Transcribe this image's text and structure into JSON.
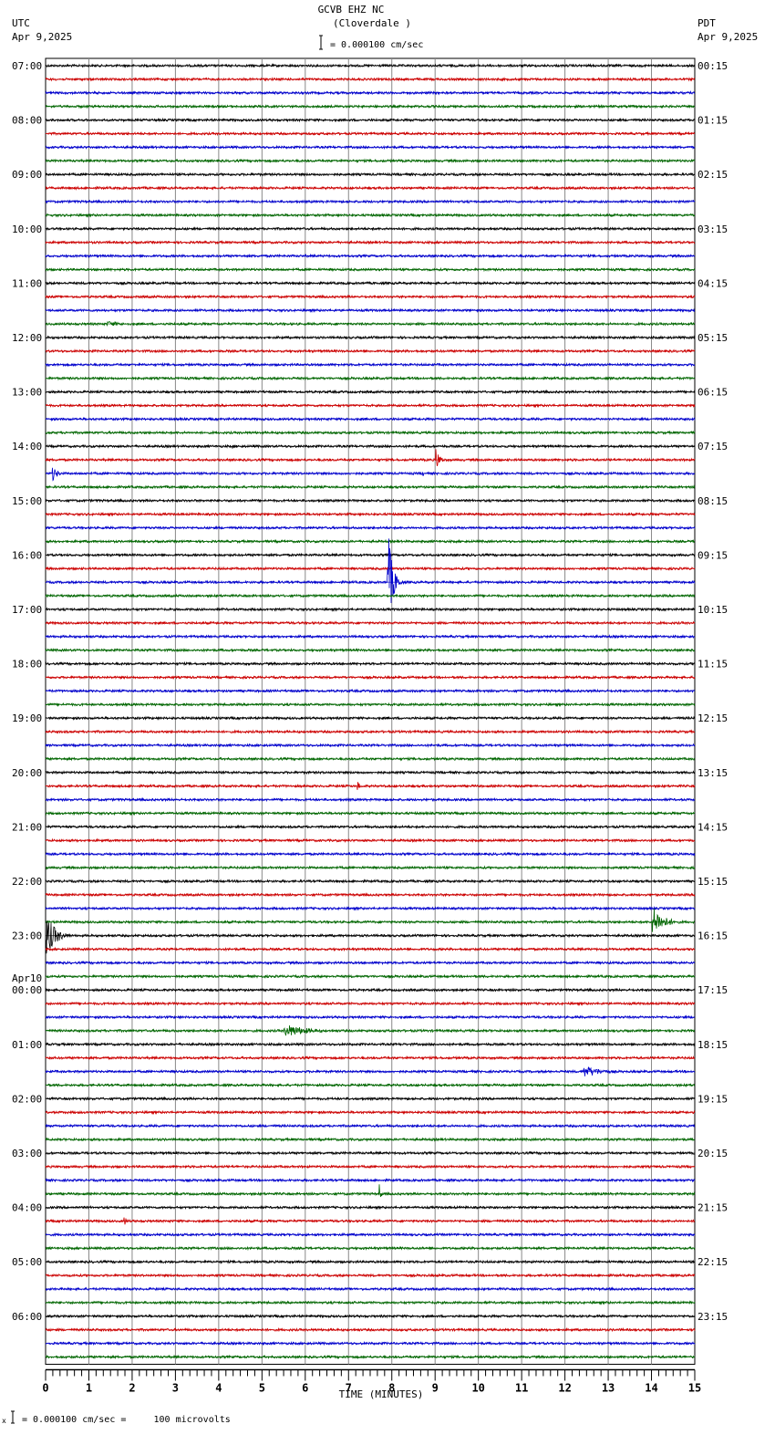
{
  "chart_data": {
    "type": "line",
    "title": "GCVB EHZ NC",
    "subtitle": "(Cloverdale )",
    "left_timezone": "UTC",
    "left_date": "Apr 9,2025",
    "right_timezone": "PDT",
    "right_date": "Apr 9,2025",
    "scale_label": "= 0.000100 cm/sec",
    "footer_scale": "= 0.000100 cm/sec =     100 microvolts",
    "footer_prefix": "x",
    "xlabel": "TIME (MINUTES)",
    "xlim": [
      0,
      15
    ],
    "x_ticks": [
      "0",
      "1",
      "2",
      "3",
      "4",
      "5",
      "6",
      "7",
      "8",
      "9",
      "10",
      "11",
      "12",
      "13",
      "14",
      "15"
    ],
    "traces_per_hour": 4,
    "trace_colors": [
      "#000000",
      "#cc0000",
      "#0000cc",
      "#006600"
    ],
    "date_change_label": "Apr10",
    "left_hour_labels": [
      "07:00",
      "08:00",
      "09:00",
      "10:00",
      "11:00",
      "12:00",
      "13:00",
      "14:00",
      "15:00",
      "16:00",
      "17:00",
      "18:00",
      "19:00",
      "20:00",
      "21:00",
      "22:00",
      "23:00",
      "00:00",
      "01:00",
      "02:00",
      "03:00",
      "04:00",
      "05:00",
      "06:00"
    ],
    "right_hour_labels": [
      "00:15",
      "01:15",
      "02:15",
      "03:15",
      "04:15",
      "05:15",
      "06:15",
      "07:15",
      "08:15",
      "09:15",
      "10:15",
      "11:15",
      "12:15",
      "13:15",
      "14:15",
      "15:15",
      "16:15",
      "17:15",
      "18:15",
      "19:15",
      "20:15",
      "21:15",
      "22:15",
      "23:15"
    ],
    "events": [
      {
        "trace": 19,
        "start_min": 1.4,
        "end_min": 3.0,
        "amplitude": 0.25
      },
      {
        "trace": 28,
        "start_min": 4.3,
        "end_min": 4.8,
        "amplitude": 0.2
      },
      {
        "trace": 29,
        "start_min": 9.0,
        "end_min": 9.4,
        "amplitude": 1.0
      },
      {
        "trace": 30,
        "start_min": 0.15,
        "end_min": 0.6,
        "amplitude": 0.7
      },
      {
        "trace": 30,
        "start_min": 8.7,
        "end_min": 8.9,
        "amplitude": 0.3
      },
      {
        "trace": 35,
        "start_min": 2.45,
        "end_min": 2.55,
        "amplitude": 0.5
      },
      {
        "trace": 38,
        "start_min": 7.9,
        "end_min": 8.3,
        "amplitude": 4.5
      },
      {
        "trace": 53,
        "start_min": 7.2,
        "end_min": 7.45,
        "amplitude": 0.5
      },
      {
        "trace": 63,
        "start_min": 14.0,
        "end_min": 15.0,
        "amplitude": 1.3
      },
      {
        "trace": 64,
        "start_min": 0.0,
        "end_min": 0.8,
        "amplitude": 1.8
      },
      {
        "trace": 71,
        "start_min": 5.5,
        "end_min": 7.6,
        "amplitude": 0.55
      },
      {
        "trace": 74,
        "start_min": 12.4,
        "end_min": 14.1,
        "amplitude": 0.5
      },
      {
        "trace": 83,
        "start_min": 7.7,
        "end_min": 7.85,
        "amplitude": 1.0
      },
      {
        "trace": 85,
        "start_min": 1.8,
        "end_min": 2.1,
        "amplitude": 0.45
      }
    ]
  }
}
